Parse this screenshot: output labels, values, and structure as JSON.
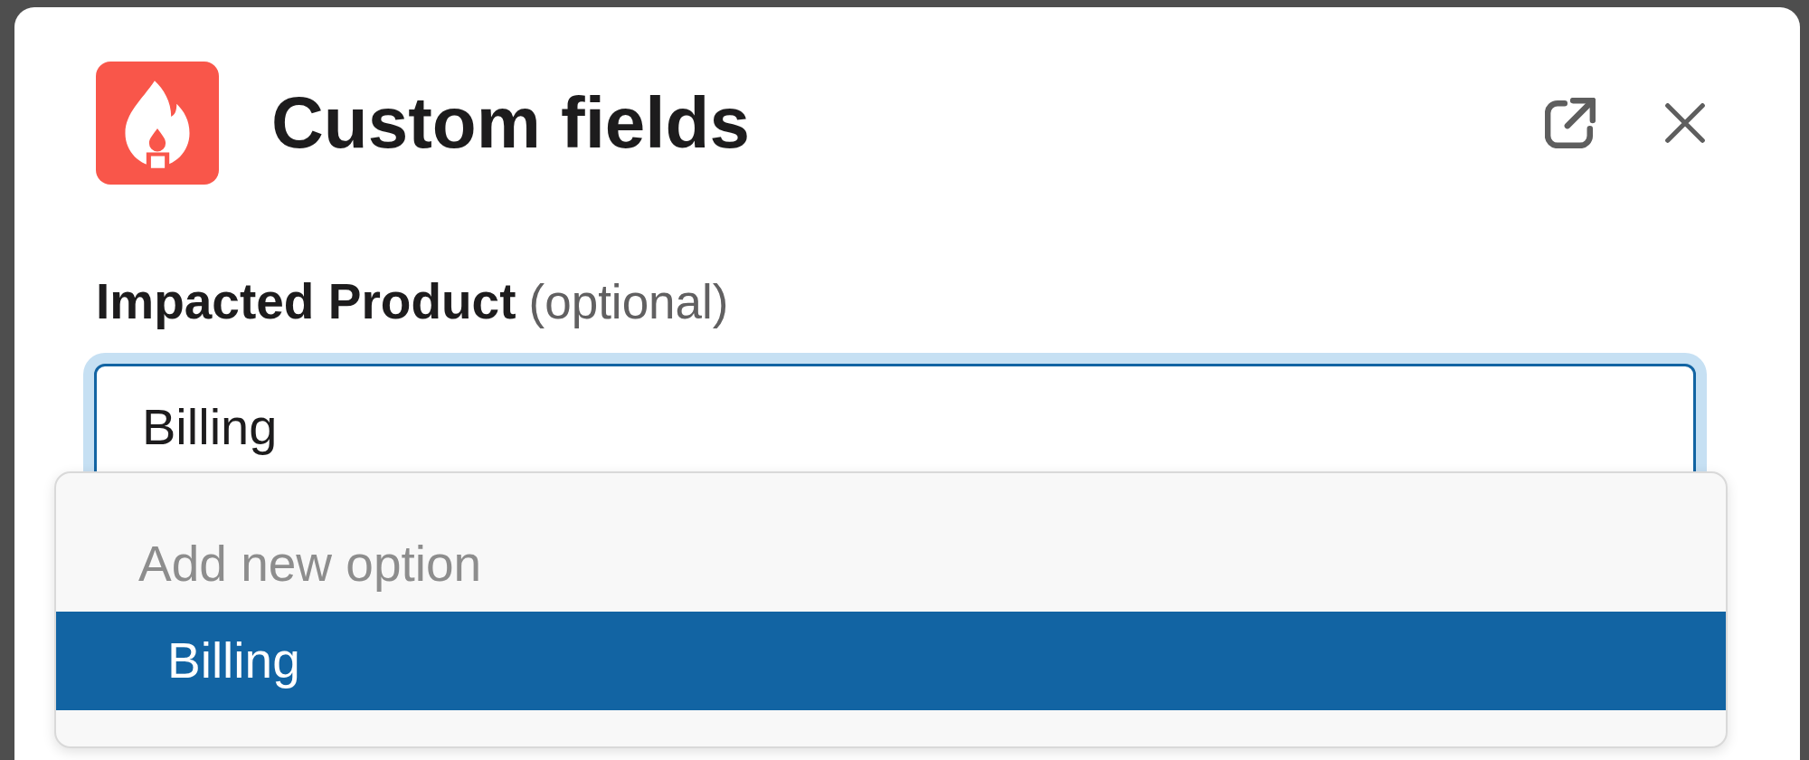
{
  "modal": {
    "title": "Custom fields"
  },
  "field": {
    "label": "Impacted Product",
    "optional_note": "(optional)",
    "value": "Billing",
    "focused": true,
    "expanded": true
  },
  "dropdown": {
    "options": [
      {
        "kind": "hint",
        "label": "Add new option",
        "selected": false
      },
      {
        "kind": "option",
        "label": "Billing",
        "selected": true
      }
    ]
  }
}
